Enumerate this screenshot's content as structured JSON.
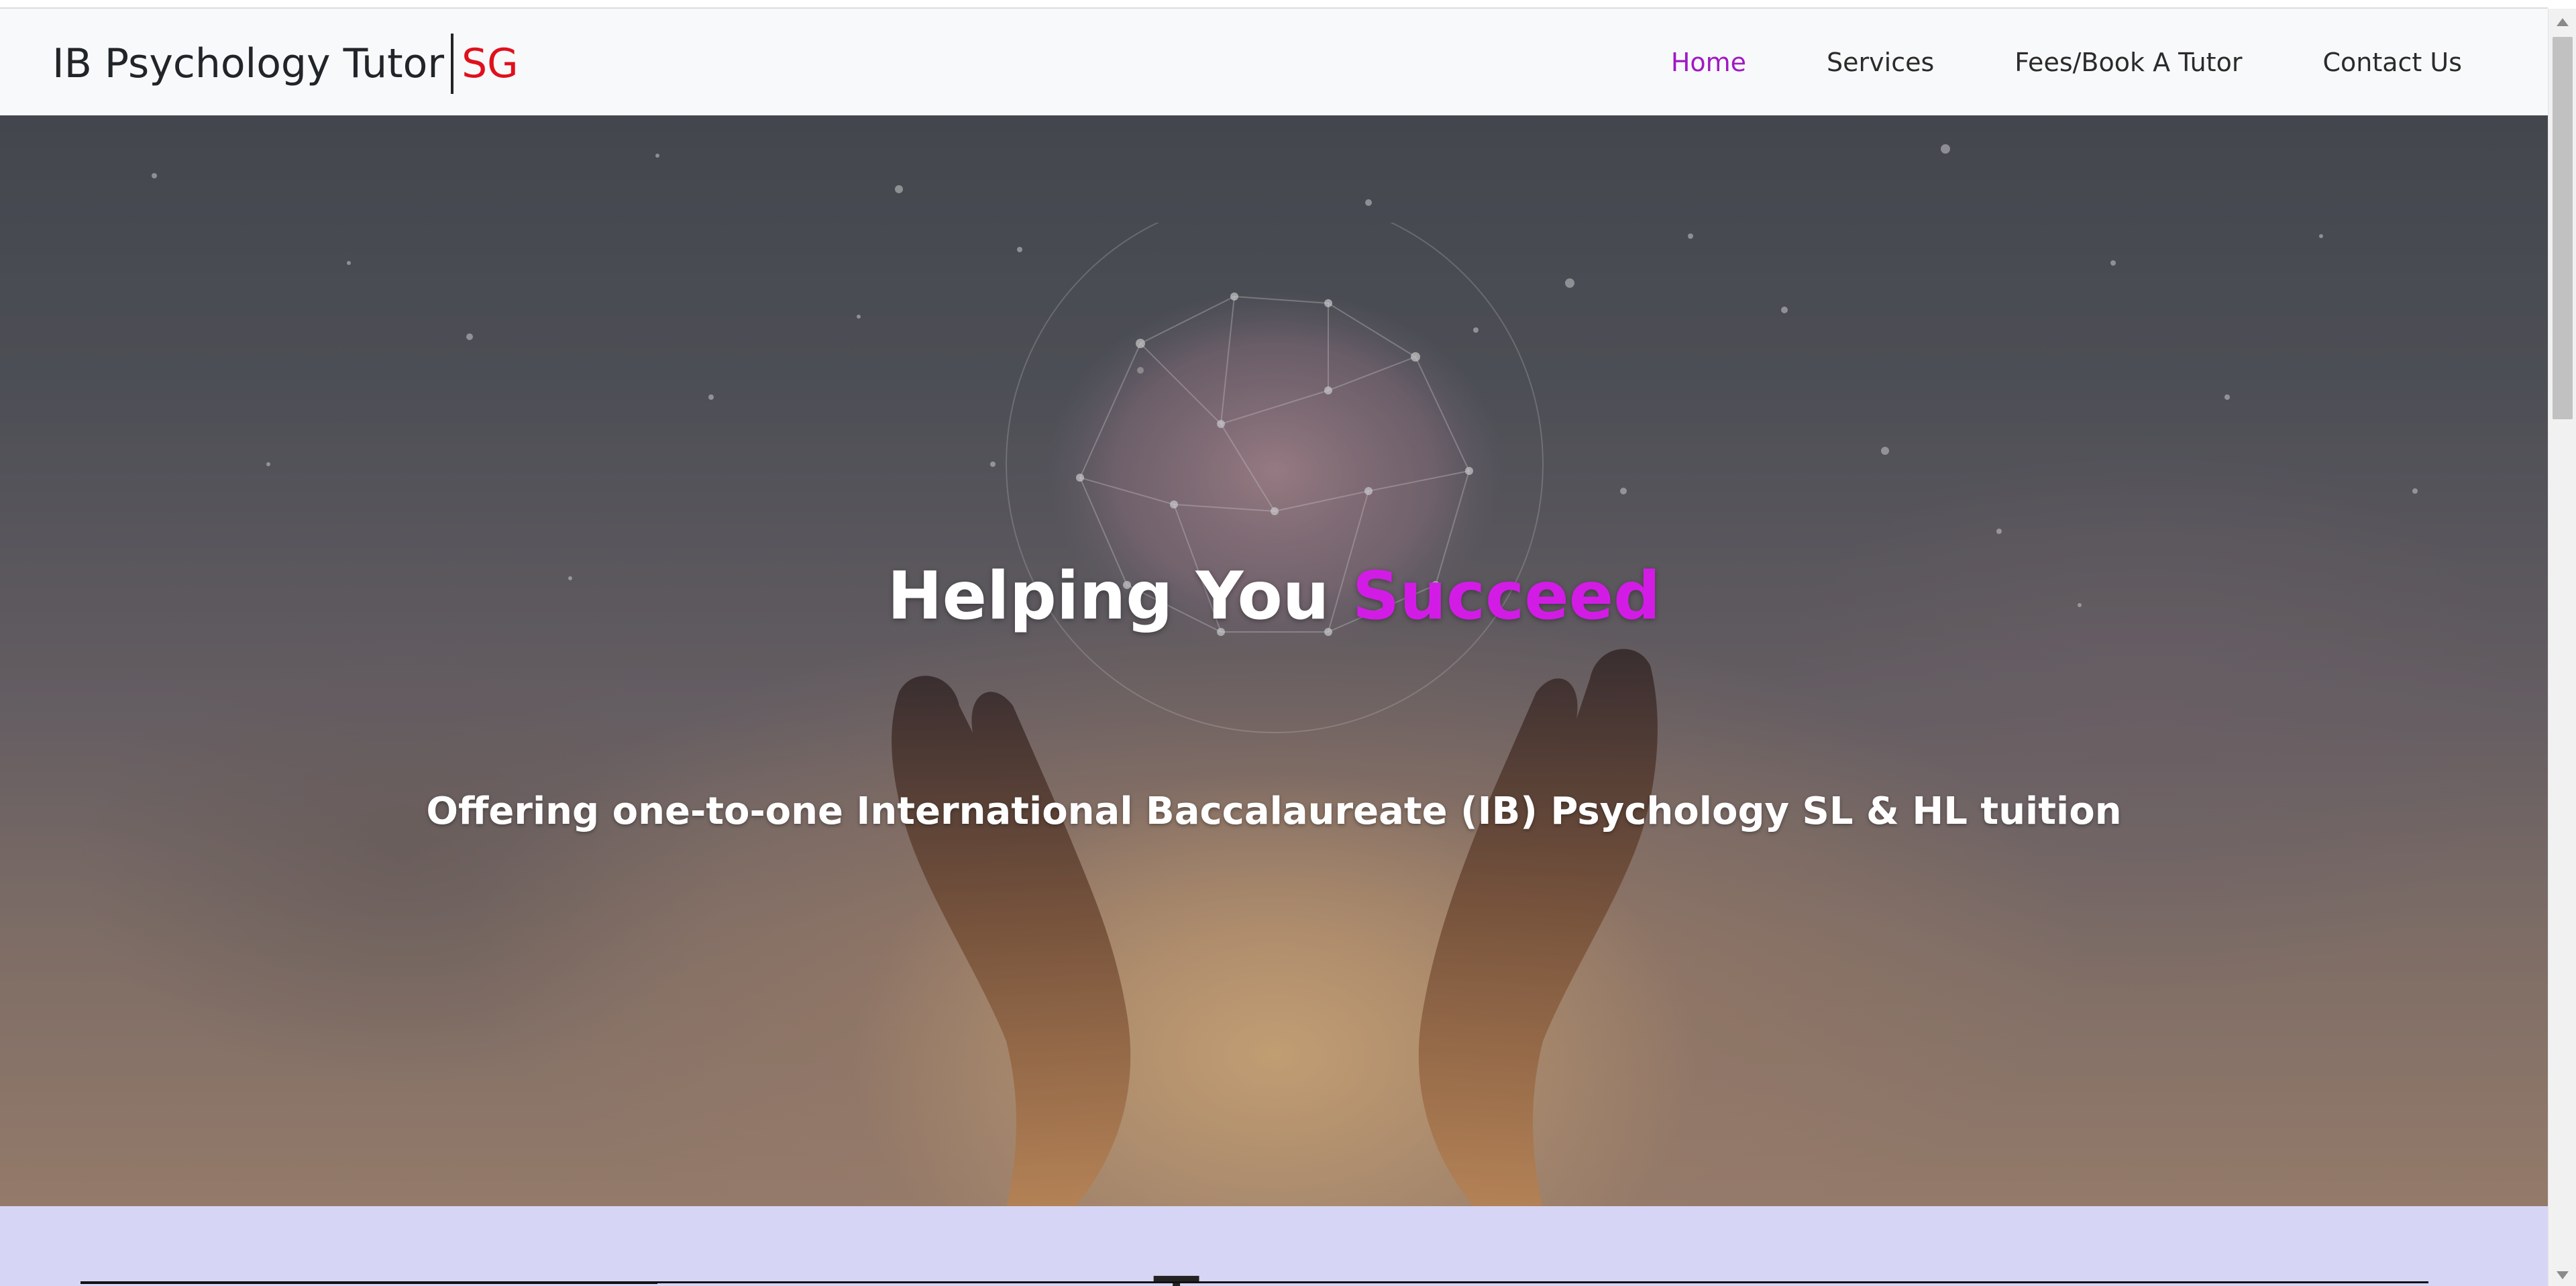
{
  "brand": {
    "name": "IB Psychology Tutor",
    "accent": "SG"
  },
  "nav": {
    "items": [
      {
        "label": "Home",
        "active": true
      },
      {
        "label": "Services",
        "active": false
      },
      {
        "label": "Fees/Book A Tutor",
        "active": false
      },
      {
        "label": "Contact Us",
        "active": false
      }
    ]
  },
  "hero": {
    "title": "Helping You",
    "title_accent": "Succeed",
    "subtitle": "Offering one-to-one International Baccalaureate (IB) Psychology SL & HL tuition",
    "image": "hands-holding-brain-network-image"
  },
  "next_section": {
    "heading_partial": "T"
  },
  "colors": {
    "nav_active": "#a019c4",
    "brand_accent": "#e0101c",
    "hero_accent": "#d21ce6",
    "section_bg": "#d6d5f5"
  }
}
